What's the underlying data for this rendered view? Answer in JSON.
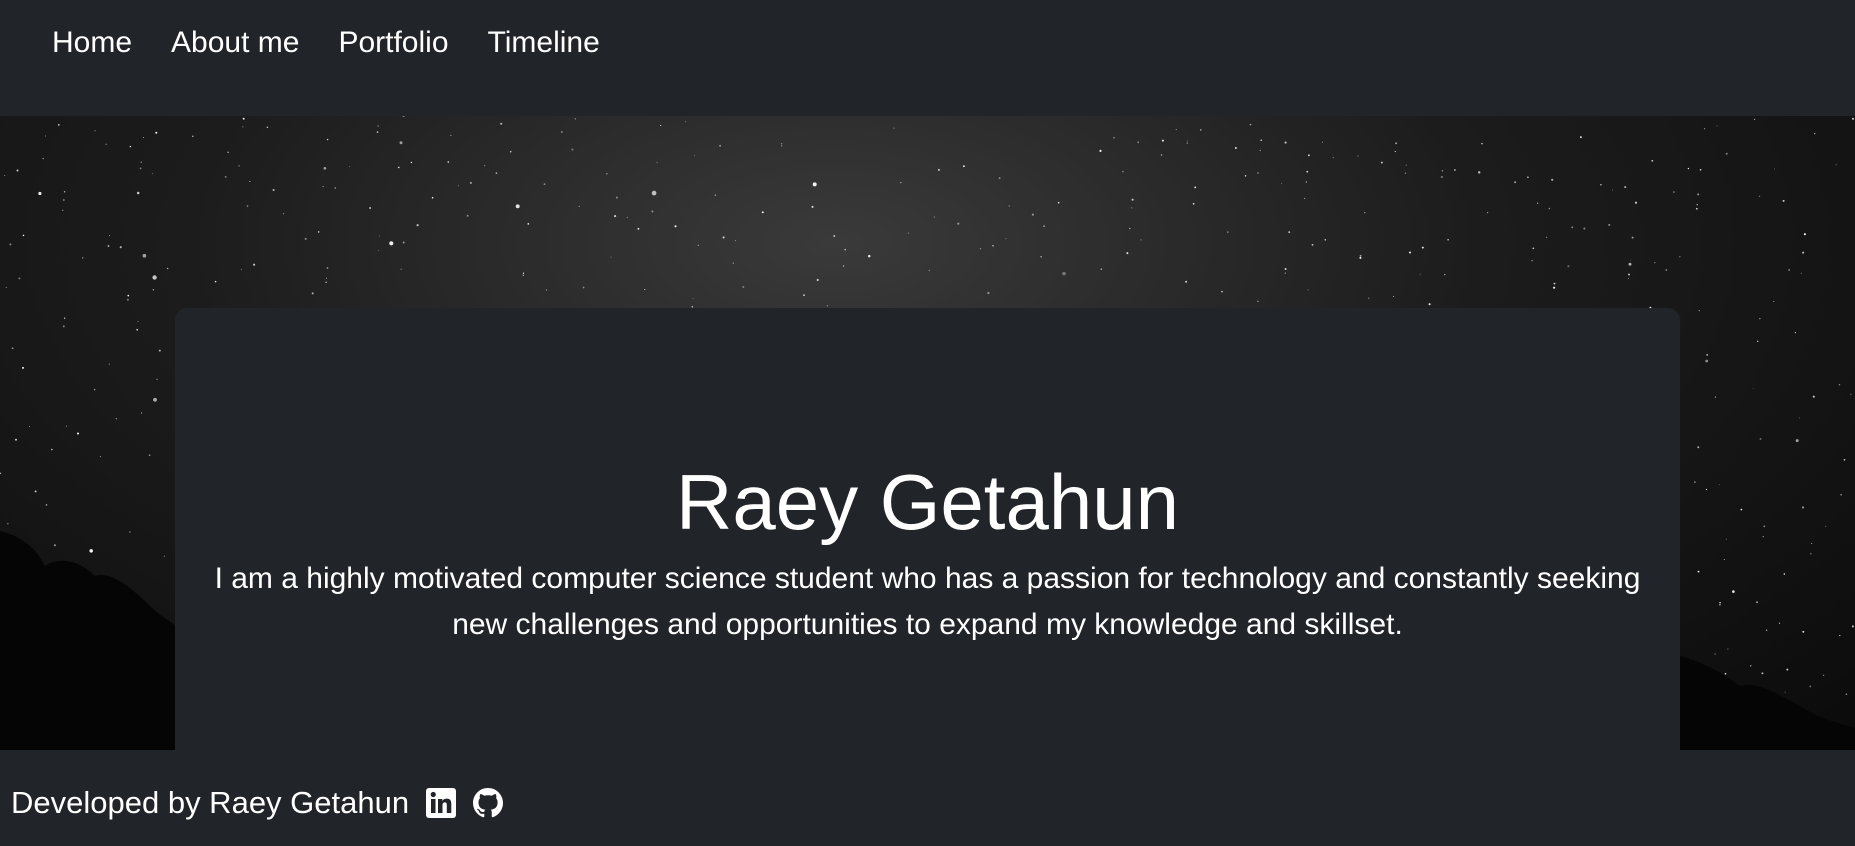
{
  "nav": {
    "items": [
      {
        "label": "Home"
      },
      {
        "label": "About me"
      },
      {
        "label": "Portfolio"
      },
      {
        "label": "Timeline"
      }
    ]
  },
  "hero": {
    "background": "starry-night-sky"
  },
  "card": {
    "title": "Raey Getahun",
    "description": "I am a highly motivated computer science student who has a passion for technology and constantly seeking new challenges and opportunities to expand my knowledge and skillset."
  },
  "footer": {
    "credit": "Developed by Raey Getahun",
    "icons": [
      {
        "name": "linkedin-icon"
      },
      {
        "name": "github-icon"
      }
    ]
  },
  "colors": {
    "surface": "#212529",
    "text": "#ffffff"
  }
}
